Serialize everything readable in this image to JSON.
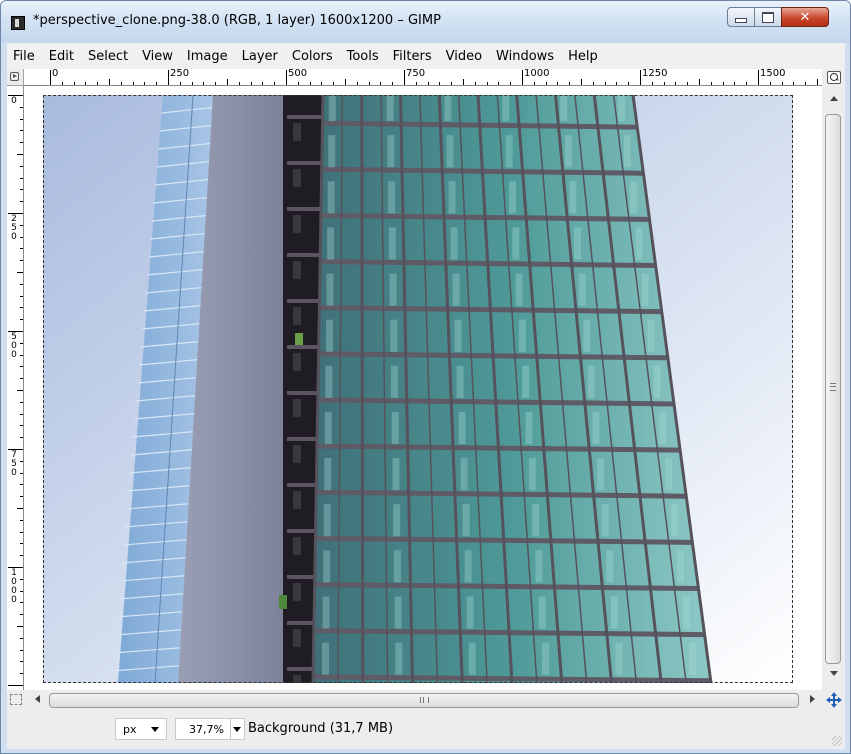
{
  "window": {
    "title": "*perspective_clone.png-38.0 (RGB, 1 layer) 1600x1200 – GIMP",
    "minimize_icon": "minimize-icon",
    "maximize_icon": "maximize-icon",
    "close_icon": "close-icon"
  },
  "menubar": {
    "items": [
      "File",
      "Edit",
      "Select",
      "View",
      "Image",
      "Layer",
      "Colors",
      "Tools",
      "Filters",
      "Video",
      "Windows",
      "Help"
    ]
  },
  "rulers": {
    "horizontal_labels": [
      "0",
      "250",
      "500",
      "750",
      "1000",
      "1250",
      "1500"
    ],
    "vertical_labels": [
      "0",
      "250",
      "500",
      "750",
      "1000"
    ]
  },
  "canvas": {
    "image_subject": "glass office tower against blue sky",
    "colors": {
      "sky_top": "#aebfe0",
      "sky_bottom": "#ffffff",
      "glass": "#4fa9a0",
      "frame": "#6e6a74",
      "dark_column": "#1e1b22"
    }
  },
  "statusbar": {
    "unit": "px",
    "zoom": "37,7%",
    "layer_info": "Background (31,7 MB)"
  },
  "icons": {
    "quick_mask": "quick-mask-icon",
    "navigate": "navigate-icon",
    "zoom_lock": "zoom-icon"
  }
}
